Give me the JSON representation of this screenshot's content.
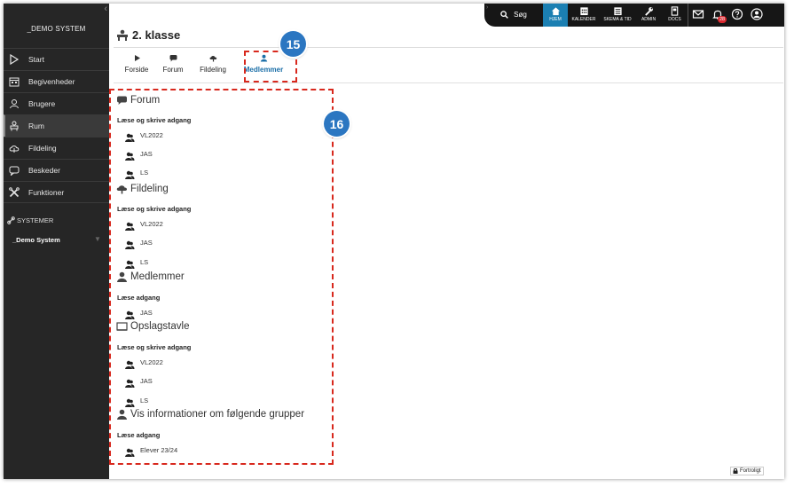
{
  "sidebar": {
    "system_title": "_DEMO SYSTEM",
    "collapse_glyph": "‹",
    "items": [
      {
        "label": "Start",
        "icon": "play-outline-icon"
      },
      {
        "label": "Begivenheder",
        "icon": "calendar-icon"
      },
      {
        "label": "Brugere",
        "icon": "users-icon"
      },
      {
        "label": "Rum",
        "icon": "room-icon"
      },
      {
        "label": "Fildeling",
        "icon": "cloud-icon"
      },
      {
        "label": "Beskeder",
        "icon": "chat-icon"
      },
      {
        "label": "Funktioner",
        "icon": "tools-icon"
      }
    ],
    "active_item": "Rum",
    "systems_label": "SYSTEMER",
    "demo_system": "_Demo System"
  },
  "topbar": {
    "search_label": "Søg",
    "nav": [
      {
        "label": "HJEM",
        "icon": "home-icon",
        "active": true
      },
      {
        "label": "KALENDER",
        "icon": "calendar-grid-icon"
      },
      {
        "label": "SKEMA & TID",
        "icon": "schedule-icon"
      },
      {
        "label": "ADMIN",
        "icon": "wrench-icon"
      },
      {
        "label": "DOCS",
        "icon": "document-icon"
      }
    ],
    "notification_count": "28"
  },
  "header": {
    "title": "2. klasse"
  },
  "tabs": [
    {
      "label": "Forside",
      "icon": "play-icon"
    },
    {
      "label": "Forum",
      "icon": "chat-icon"
    },
    {
      "label": "Fildeling",
      "icon": "cloud-icon"
    },
    {
      "label": "Medlemmer",
      "icon": "user-icon",
      "active": true
    }
  ],
  "callouts": {
    "step_15": "15",
    "step_16": "16",
    "color": "#d8281d",
    "badge_color": "#2b76c1"
  },
  "sections": [
    {
      "title": "Forum",
      "icon": "chat-icon",
      "access": "Læse og skrive adgang",
      "members": [
        "VL2022",
        "JAS",
        "LS"
      ]
    },
    {
      "title": "Fildeling",
      "icon": "cloud-icon",
      "access": "Læse og skrive adgang",
      "members": [
        "VL2022",
        "JAS",
        "LS"
      ]
    },
    {
      "title": "Medlemmer",
      "icon": "user-icon",
      "access": "Læse adgang",
      "members": [
        "JAS"
      ]
    },
    {
      "title": "Opslagstavle",
      "icon": "board-icon",
      "access": "Læse og skrive adgang",
      "members": [
        "VL2022",
        "JAS",
        "LS"
      ]
    },
    {
      "title": "Vis informationer om følgende grupper",
      "icon": "user-icon",
      "access": "Læse adgang",
      "members": [
        "Elever 23/24"
      ]
    }
  ],
  "footer": {
    "confidential_label": "Fortroligt"
  },
  "colors": {
    "sidebar_bg": "#262626",
    "topbar_bg": "#161616",
    "accent": "#1b7fb2",
    "active_tab": "#1b6fa8"
  }
}
